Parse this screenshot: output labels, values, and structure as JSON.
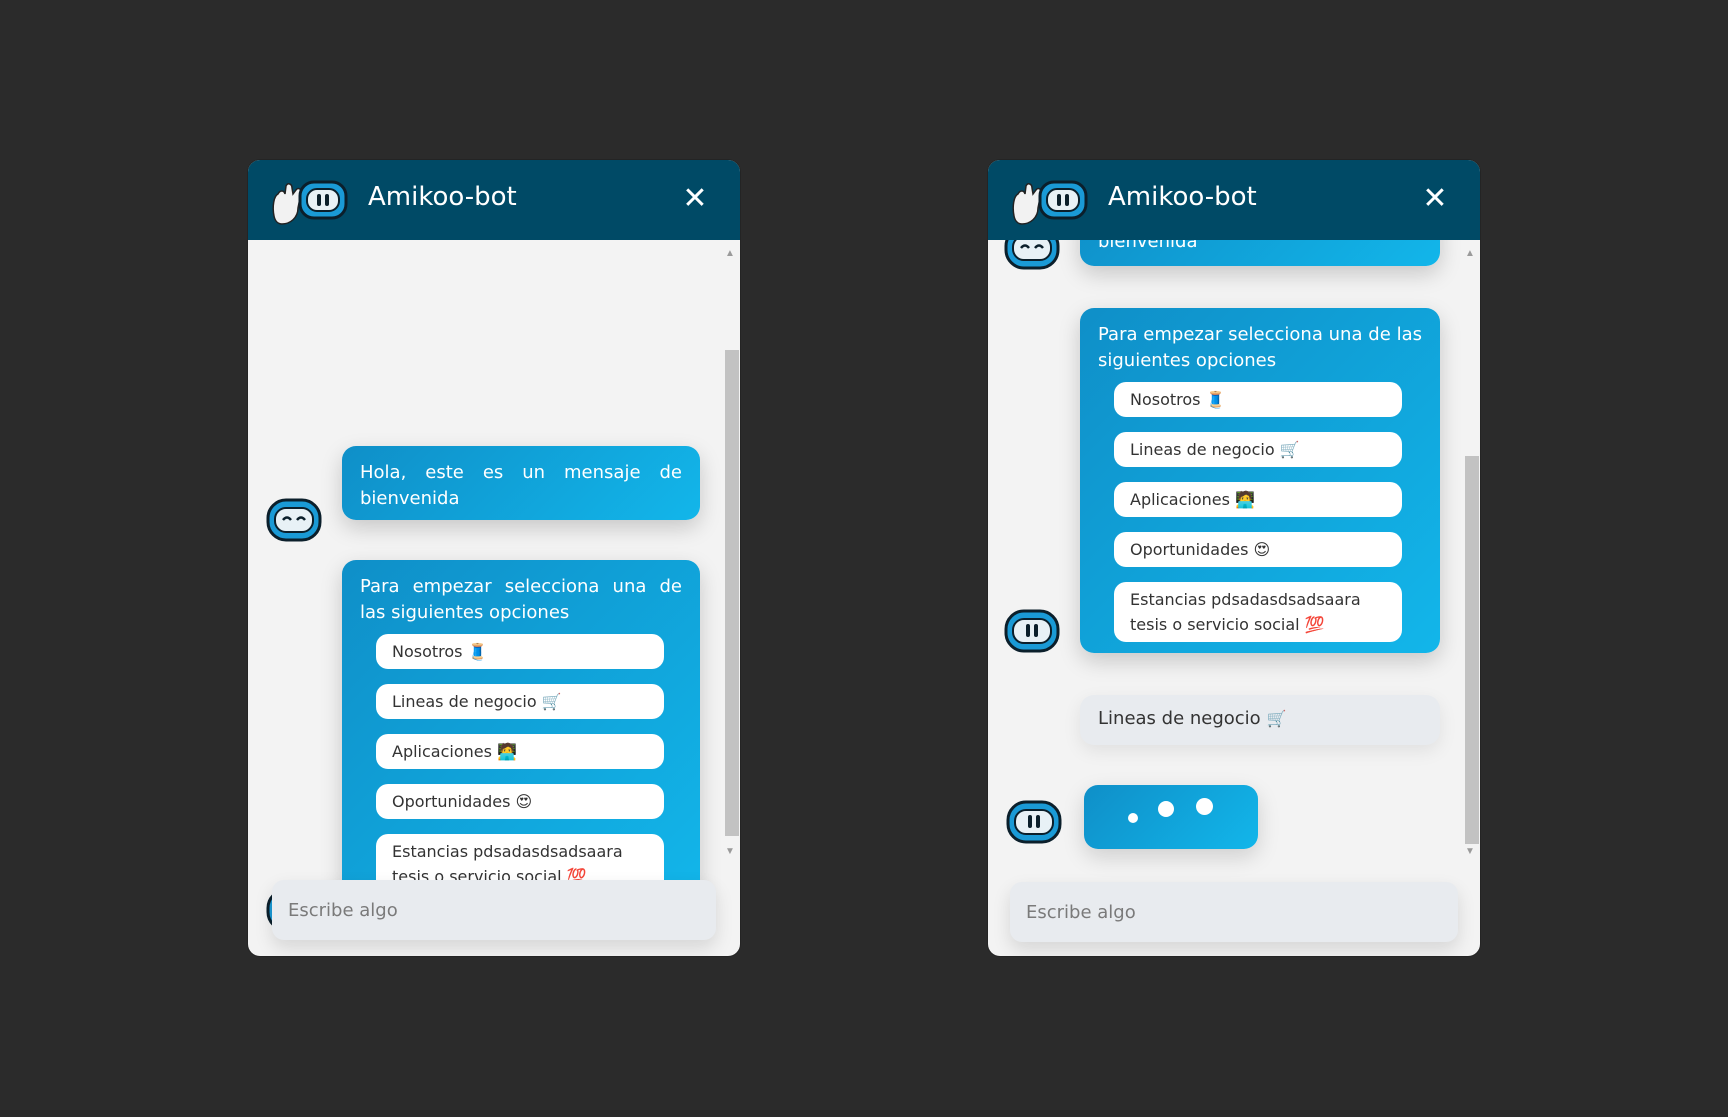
{
  "colors": {
    "header": "#004a66",
    "bubble_start": "#0f8fc8",
    "bubble_end": "#12b6ea",
    "page_bg": "#2b2b2b",
    "chat_bg": "#f3f3f3"
  },
  "window_left": {
    "title": "Amikoo-bot",
    "close_label": "✕",
    "welcome": "Hola, este es un mensaje de bienvenida",
    "prompt": "Para empezar selecciona una de las siguientes opciones",
    "options": [
      {
        "label": "Nosotros",
        "emoji": "🧵"
      },
      {
        "label": "Lineas de negocio",
        "emoji": "🛒"
      },
      {
        "label": "Aplicaciones",
        "emoji": "🧑‍💻"
      },
      {
        "label": "Oportunidades",
        "emoji": "😍"
      },
      {
        "label": "Estancias pdsadasdsadsaara tesis o servicio social",
        "emoji": "💯"
      }
    ],
    "input_placeholder": "Escribe algo"
  },
  "window_right": {
    "title": "Amikoo-bot",
    "close_label": "✕",
    "welcome_tail": "bienvenida",
    "prompt": "Para empezar selecciona una de las siguientes opciones",
    "options": [
      {
        "label": "Nosotros",
        "emoji": "🧵"
      },
      {
        "label": "Lineas de negocio",
        "emoji": "🛒"
      },
      {
        "label": "Aplicaciones",
        "emoji": "🧑‍💻"
      },
      {
        "label": "Oportunidades",
        "emoji": "😍"
      },
      {
        "label": "Estancias pdsadasdsadsaara tesis o servicio social",
        "emoji": "💯"
      }
    ],
    "user_reply": "Lineas de negocio",
    "user_reply_emoji": "🛒",
    "input_placeholder": "Escribe algo"
  }
}
